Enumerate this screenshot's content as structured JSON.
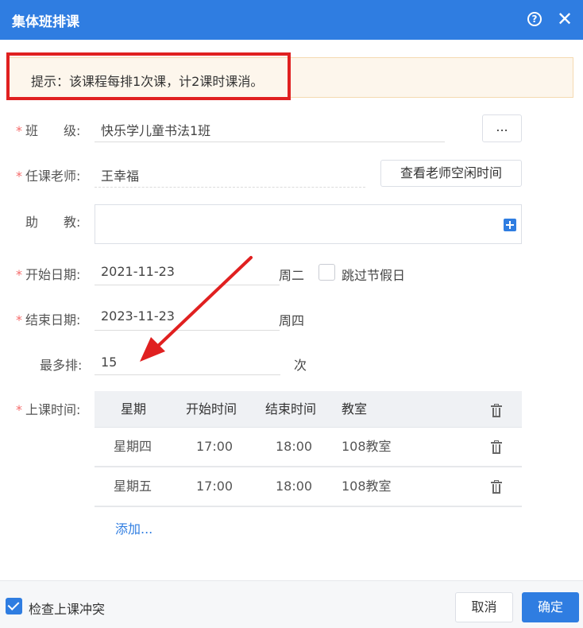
{
  "dialog": {
    "title": "集体班排课",
    "help_icon": "question-circle-icon",
    "close_icon": "close-icon",
    "accent_color": "#2f7de1"
  },
  "tip": {
    "text": "提示：该课程每排1次课，计2课时课消。"
  },
  "form": {
    "class": {
      "label": "班　　级:",
      "value": "快乐学儿童书法1班",
      "button": "..."
    },
    "teacher": {
      "label": "任课老师:",
      "value": "王幸福",
      "button": "查看老师空闲时间"
    },
    "assistant": {
      "label": "助　　教:",
      "value": ""
    },
    "start_date": {
      "label": "开始日期:",
      "value": "2021-11-23",
      "weekday": "周二",
      "skip_holidays_label": "跳过节假日",
      "skip_holidays_checked": false
    },
    "end_date": {
      "label": "结束日期:",
      "value": "2023-11-23",
      "weekday": "周四"
    },
    "max": {
      "label": "最多排:",
      "value": "15",
      "unit": "次"
    },
    "schedule": {
      "label": "上课时间:"
    }
  },
  "schedule_table": {
    "headers": [
      "星期",
      "开始时间",
      "结束时间",
      "教室"
    ],
    "rows": [
      {
        "day": "星期四",
        "start": "17:00",
        "end": "18:00",
        "room": "108教室"
      },
      {
        "day": "星期五",
        "start": "17:00",
        "end": "18:00",
        "room": "108教室"
      }
    ],
    "add_label": "添加..."
  },
  "footer": {
    "check_conflict_label": "检查上课冲突",
    "check_conflict_checked": true,
    "cancel_label": "取消",
    "ok_label": "确定"
  }
}
